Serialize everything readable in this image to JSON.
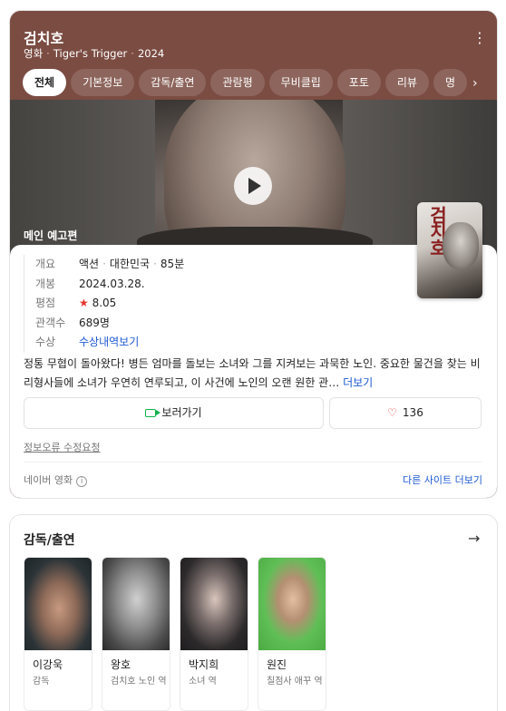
{
  "header": {
    "title": "검치호",
    "meta": [
      "영화",
      "Tiger's Trigger",
      "2024"
    ]
  },
  "tabs": [
    "전체",
    "기본정보",
    "감독/출연",
    "관람평",
    "무비클립",
    "포토",
    "리뷰",
    "명"
  ],
  "video": {
    "label": "메인 예고편"
  },
  "poster": {
    "title_glyphs": "검치호"
  },
  "details": {
    "overview_label": "개요",
    "overview": [
      "액션",
      "대한민국",
      "85분"
    ],
    "release_label": "개봉",
    "release": "2024.03.28.",
    "rating_label": "평점",
    "rating": "8.05",
    "audience_label": "관객수",
    "audience": "689명",
    "awards_label": "수상",
    "awards": "수상내역보기"
  },
  "synopsis": {
    "text": "정통 무협이 돌아왔다! 병든 엄마를 돌보는 소녀와 그를 지켜보는 과묵한 노인. 중요한 물건을 찾는 비리형사들에 소녀가 우연히 연루되고, 이 사건에 노인의 오랜 원한 관…",
    "more": "더보기"
  },
  "actions": {
    "watch": "보러가기",
    "likes": "136"
  },
  "report": "정보오류 수정요청",
  "footer": {
    "source": "네이버 영화",
    "other_sites": "다른 사이트 더보기"
  },
  "cast": {
    "title": "감독/출연",
    "people": [
      {
        "name": "이강욱",
        "role": "감독"
      },
      {
        "name": "왕호",
        "role": "검치호 노인 역"
      },
      {
        "name": "박지희",
        "role": "소녀 역"
      },
      {
        "name": "원진",
        "role": "칠점사 애꾸 역"
      }
    ]
  },
  "colors": {
    "header_bg": "#7b4c42",
    "link": "#1e5ad2",
    "star": "#e5342f"
  },
  "icons": [
    "more-vert-icon",
    "chevron-right-icon",
    "play-icon",
    "star-icon",
    "video-camera-icon",
    "heart-icon",
    "info-icon",
    "arrow-right-icon"
  ]
}
